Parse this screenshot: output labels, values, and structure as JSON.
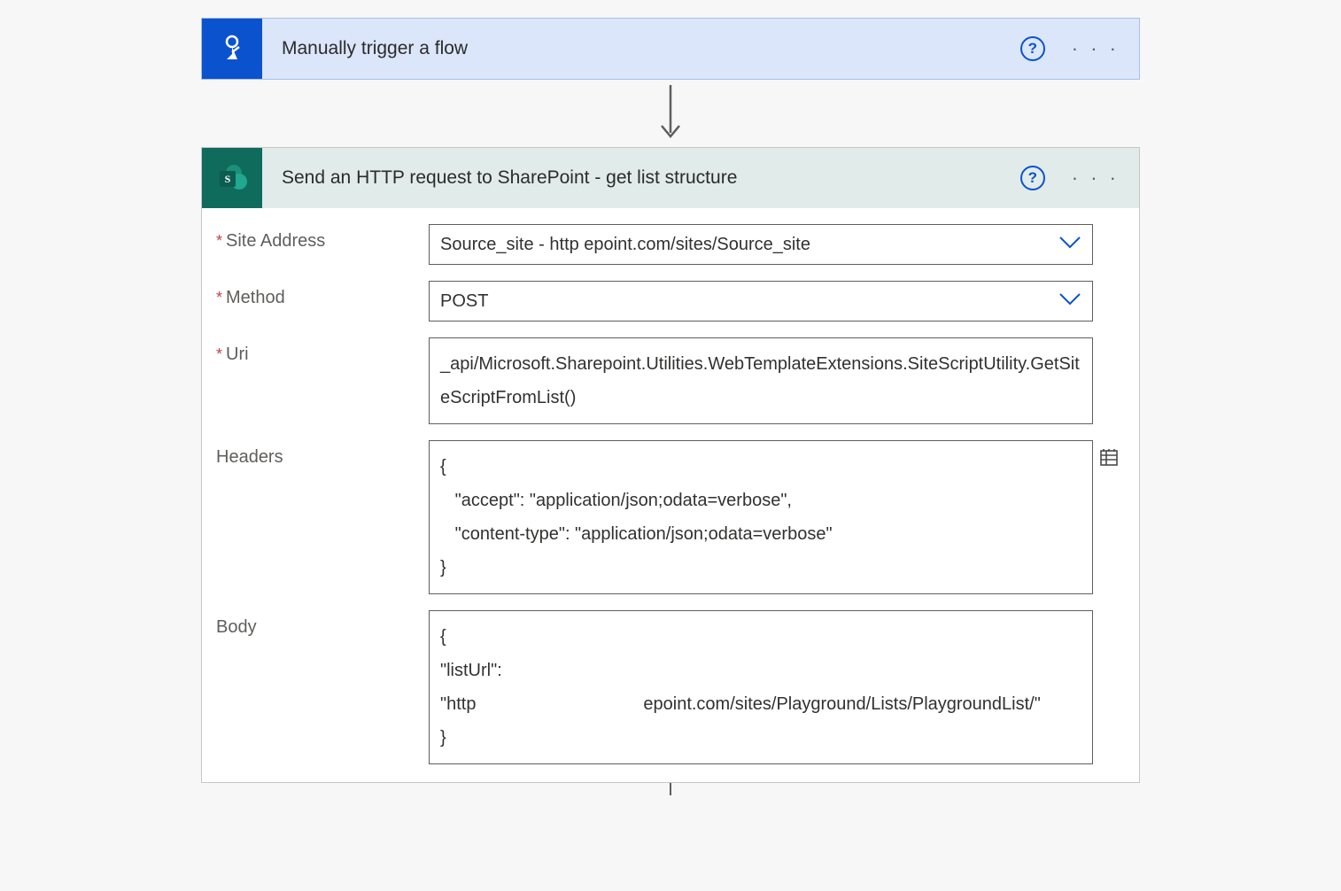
{
  "trigger": {
    "title": "Manually trigger a flow",
    "help": "?",
    "more": "· · ·"
  },
  "action": {
    "title": "Send an HTTP request to SharePoint - get list structure",
    "help": "?",
    "more": "· · ·",
    "fields": {
      "siteAddress": {
        "label": "Site Address",
        "value": "Source_site - http                              epoint.com/sites/Source_site"
      },
      "method": {
        "label": "Method",
        "value": "POST"
      },
      "uri": {
        "label": "Uri",
        "value": "_api/Microsoft.Sharepoint.Utilities.WebTemplateExtensions.SiteScriptUtility.GetSiteScriptFromList()"
      },
      "headers": {
        "label": "Headers",
        "value": "{\n   \"accept\": \"application/json;odata=verbose\",\n   \"content-type\": \"application/json;odata=verbose\"\n}"
      },
      "body": {
        "label": "Body",
        "value": "{\n\"listUrl\":\n\"http                                  epoint.com/sites/Playground/Lists/PlaygroundList/\"\n}"
      }
    }
  }
}
